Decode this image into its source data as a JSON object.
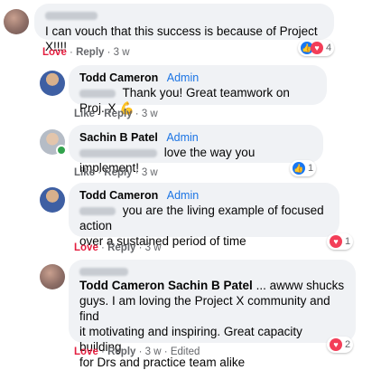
{
  "actions": {
    "love": "Love",
    "like": "Like",
    "reply": "Reply",
    "sep": "·"
  },
  "comments": [
    {
      "author": "",
      "admin": "",
      "text": "I can vouch that this success is because of Project X!!!!",
      "time": "3 w",
      "reactions": {
        "icons": [
          "like",
          "love"
        ],
        "count": "4"
      },
      "reaction": "Love"
    },
    {
      "author": "Todd Cameron",
      "admin": "Admin",
      "text": "Thank you! Great teamwork on Proj. X",
      "emoji": "💪",
      "time": "3 w",
      "reaction": "Like"
    },
    {
      "author": "Sachin B Patel",
      "admin": "Admin",
      "text": "love the way you implement!",
      "time": "3 w",
      "reactions": {
        "icons": [
          "like"
        ],
        "count": "1"
      },
      "reaction": "Like"
    },
    {
      "author": "Todd Cameron",
      "admin": "Admin",
      "text_line1": "you are the living example of focused action",
      "text_line2": "over a sustained period of time",
      "time": "3 w",
      "reactions": {
        "icons": [
          "love"
        ],
        "count": "1"
      },
      "reaction": "Love"
    },
    {
      "author": "",
      "tags": "Todd Cameron Sachin B Patel",
      "text_line1": "... awww shucks",
      "text_line2": "guys. I am loving the Project X community and find",
      "text_line3": "it motivating and inspiring. Great capacity building",
      "text_line4": "for Drs and practice team alike",
      "time": "3 w",
      "edited": "Edited",
      "reactions": {
        "icons": [
          "love"
        ],
        "count": "2"
      },
      "reaction": "Love"
    }
  ]
}
